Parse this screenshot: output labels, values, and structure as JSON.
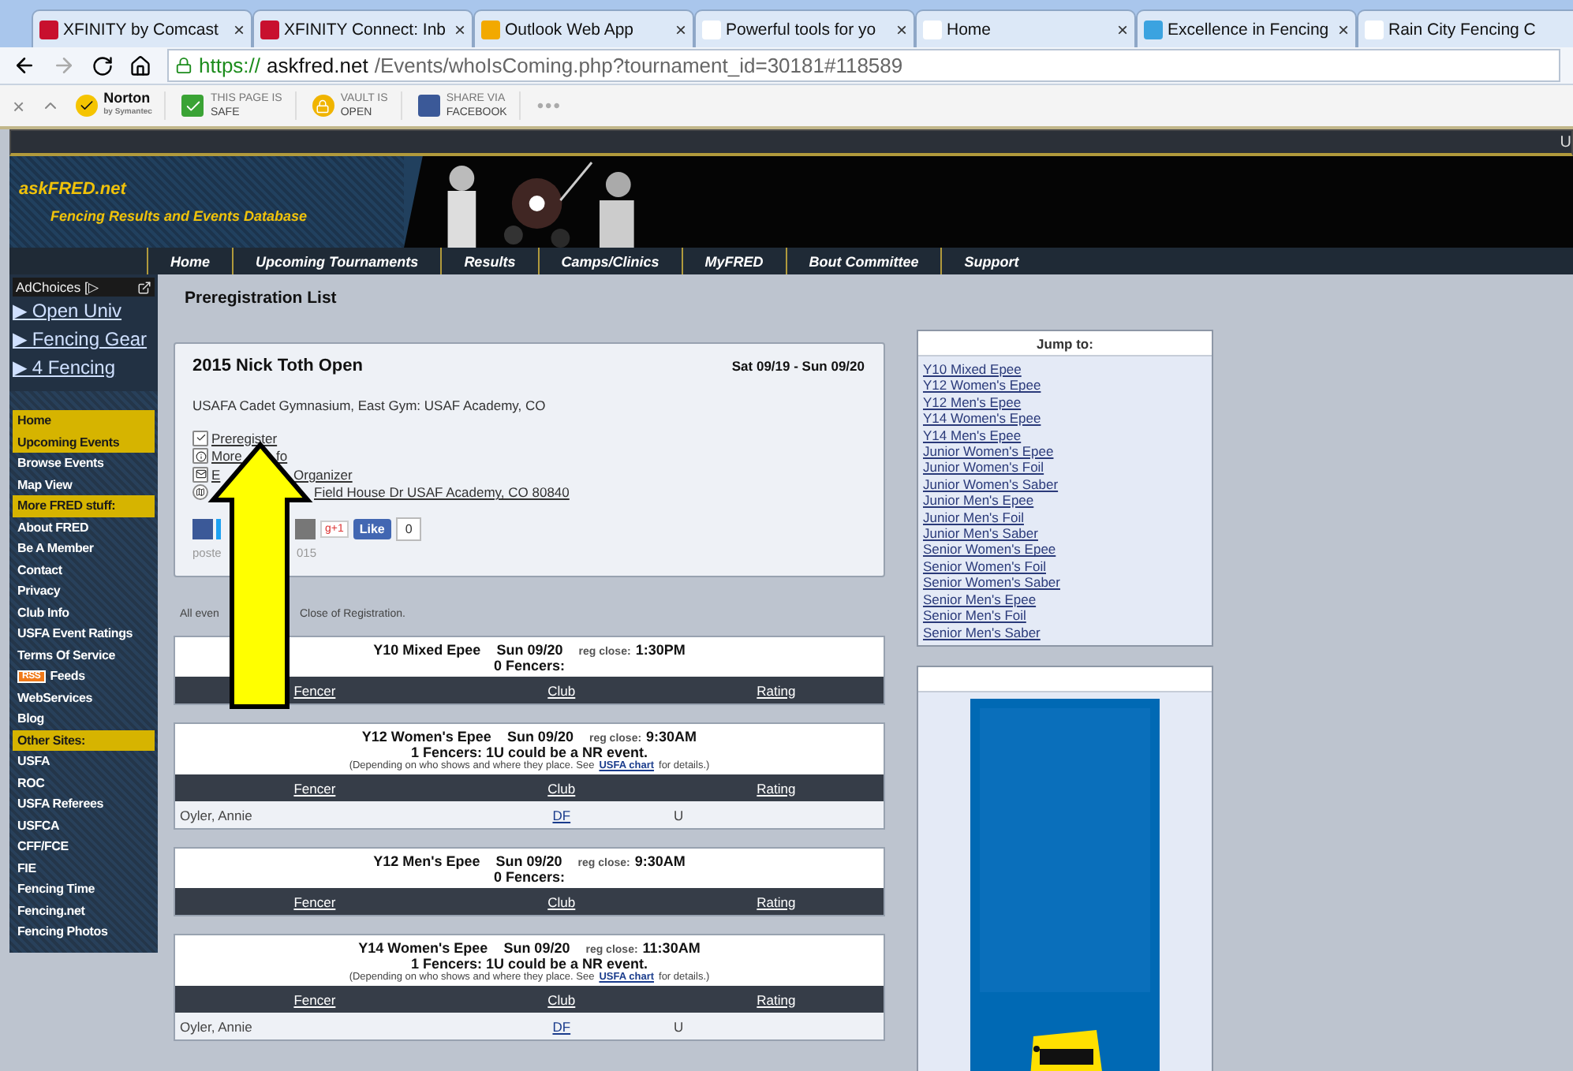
{
  "browser": {
    "tabs": [
      {
        "title": "XFINITY by Comcast",
        "close": "×"
      },
      {
        "title": "XFINITY Connect: Inb",
        "close": "×"
      },
      {
        "title": "Outlook Web App",
        "close": "×"
      },
      {
        "title": "Powerful tools for yo",
        "close": "×"
      },
      {
        "title": "Home",
        "close": "×"
      },
      {
        "title": "Excellence in Fencing",
        "close": "×"
      },
      {
        "title": "Rain City Fencing C"
      }
    ],
    "url": {
      "scheme": "https://",
      "host": "askfred.net",
      "path": "/Events/whoIsComing.php?tournament_id=30181#118589"
    },
    "toolbar": {
      "close": "×",
      "norton": "Norton",
      "norton_sub": "by Symantec",
      "items": [
        {
          "kind": "safe",
          "line1": "THIS PAGE IS",
          "line2": "SAFE"
        },
        {
          "kind": "vault",
          "line1": "VAULT IS",
          "line2": "OPEN"
        },
        {
          "kind": "facebook",
          "line1": "SHARE VIA",
          "line2": "FACEBOOK"
        }
      ],
      "more": "•••"
    }
  },
  "site": {
    "top_bar_text": "U",
    "logo": "askFRED.net",
    "tagline": "Fencing Results and Events Database",
    "nav": [
      "Home",
      "Upcoming Tournaments",
      "Results",
      "Camps/Clinics",
      "MyFRED",
      "Bout Committee",
      "Support"
    ]
  },
  "sidebar": {
    "ad_label": "AdChoices [▷",
    "ads": [
      "▶ Open Univ",
      "▶ Fencing Gear",
      "▶ 4 Fencing"
    ],
    "items": [
      {
        "label": "Home",
        "kind": "current"
      },
      {
        "label": "Upcoming Events",
        "kind": "current"
      },
      {
        "label": "Browse Events",
        "kind": "link"
      },
      {
        "label": "Map View",
        "kind": "link"
      },
      {
        "label": "More FRED stuff:",
        "kind": "section"
      },
      {
        "label": "About FRED",
        "kind": "link"
      },
      {
        "label": "Be A Member",
        "kind": "link"
      },
      {
        "label": "Contact",
        "kind": "link"
      },
      {
        "label": "Privacy",
        "kind": "link"
      },
      {
        "label": "Club Info",
        "kind": "link"
      },
      {
        "label": "USFA Event Ratings",
        "kind": "link"
      },
      {
        "label": "Terms Of Service",
        "kind": "link"
      },
      {
        "label": "Feeds",
        "kind": "feed",
        "badge": "RSS"
      },
      {
        "label": "WebServices",
        "kind": "link"
      },
      {
        "label": "Blog",
        "kind": "link"
      },
      {
        "label": "Other Sites:",
        "kind": "section"
      },
      {
        "label": "USFA",
        "kind": "link"
      },
      {
        "label": "ROC",
        "kind": "link"
      },
      {
        "label": "USFA Referees",
        "kind": "link"
      },
      {
        "label": "USFCA",
        "kind": "link"
      },
      {
        "label": "CFF/FCE",
        "kind": "link"
      },
      {
        "label": "FIE",
        "kind": "link"
      },
      {
        "label": "Fencing Time",
        "kind": "link"
      },
      {
        "label": "Fencing.net",
        "kind": "link"
      },
      {
        "label": "Fencing Photos",
        "kind": "link"
      }
    ]
  },
  "main": {
    "heading": "Preregistration List",
    "tournament": {
      "title": "2015 Nick Toth Open",
      "dates": "Sat 09/19 - Sun 09/20",
      "location": "USAFA Cadet Gymnasium, East Gym: USAF Academy, CO",
      "links": [
        {
          "kind": "preregister",
          "parts": [
            "Preregister"
          ]
        },
        {
          "kind": "info",
          "parts": [
            "More",
            "fo"
          ]
        },
        {
          "kind": "email",
          "parts": [
            "E",
            "Organizer"
          ]
        },
        {
          "kind": "map",
          "parts": [
            "Field House Dr USAF Academy, CO 80840"
          ]
        }
      ],
      "social": {
        "gplus": "g+1",
        "like": "Like",
        "count": "0"
      },
      "posted": [
        "poste",
        "015"
      ]
    },
    "note": [
      "All even",
      "Close of Registration."
    ],
    "events": [
      {
        "title": "Y10 Mixed Epee",
        "date": "Sun 09/20",
        "reg_label": "reg close:",
        "reg_time": "1:30PM",
        "summary": "0 Fencers:",
        "columns": [
          "Fencer",
          "Club",
          "Rating"
        ]
      },
      {
        "title": "Y12 Women's Epee",
        "date": "Sun 09/20",
        "reg_label": "reg close:",
        "reg_time": "9:30AM",
        "summary": "1 Fencers: 1U  could be a NR event.",
        "detail": {
          "before": "(Depending on who shows and where they place.  See",
          "link": "USFA chart",
          "after": "for details.)"
        },
        "columns": [
          "Fencer",
          "Club",
          "Rating"
        ],
        "rows": [
          {
            "fencer": "Oyler, Annie",
            "club": "DF",
            "rating": "U"
          }
        ]
      },
      {
        "title": "Y12 Men's Epee",
        "date": "Sun 09/20",
        "reg_label": "reg close:",
        "reg_time": "9:30AM",
        "summary": "0 Fencers:",
        "columns": [
          "Fencer",
          "Club",
          "Rating"
        ]
      },
      {
        "title": "Y14 Women's Epee",
        "date": "Sun 09/20",
        "reg_label": "reg close:",
        "reg_time": "11:30AM",
        "summary": "1 Fencers: 1U  could be a NR event.",
        "detail": {
          "before": "(Depending on who shows and where they place.  See",
          "link": "USFA chart",
          "after": "for details.)"
        },
        "columns": [
          "Fencer",
          "Club",
          "Rating"
        ],
        "rows": [
          {
            "fencer": "Oyler, Annie",
            "club": "DF",
            "rating": "U"
          }
        ]
      }
    ]
  },
  "jump": {
    "title": "Jump to:",
    "links": [
      "Y10 Mixed Epee",
      "Y12 Women's Epee",
      "Y12 Men's Epee",
      "Y14 Women's Epee",
      "Y14 Men's Epee",
      "Junior Women's Epee",
      "Junior Women's Foil",
      "Junior Women's Saber",
      "Junior Men's Epee",
      "Junior Men's Foil",
      "Junior Men's Saber",
      "Senior Women's Epee",
      "Senior Women's Foil",
      "Senior Women's Saber",
      "Senior Men's Epee",
      "Senior Men's Foil",
      "Senior Men's Saber"
    ]
  }
}
